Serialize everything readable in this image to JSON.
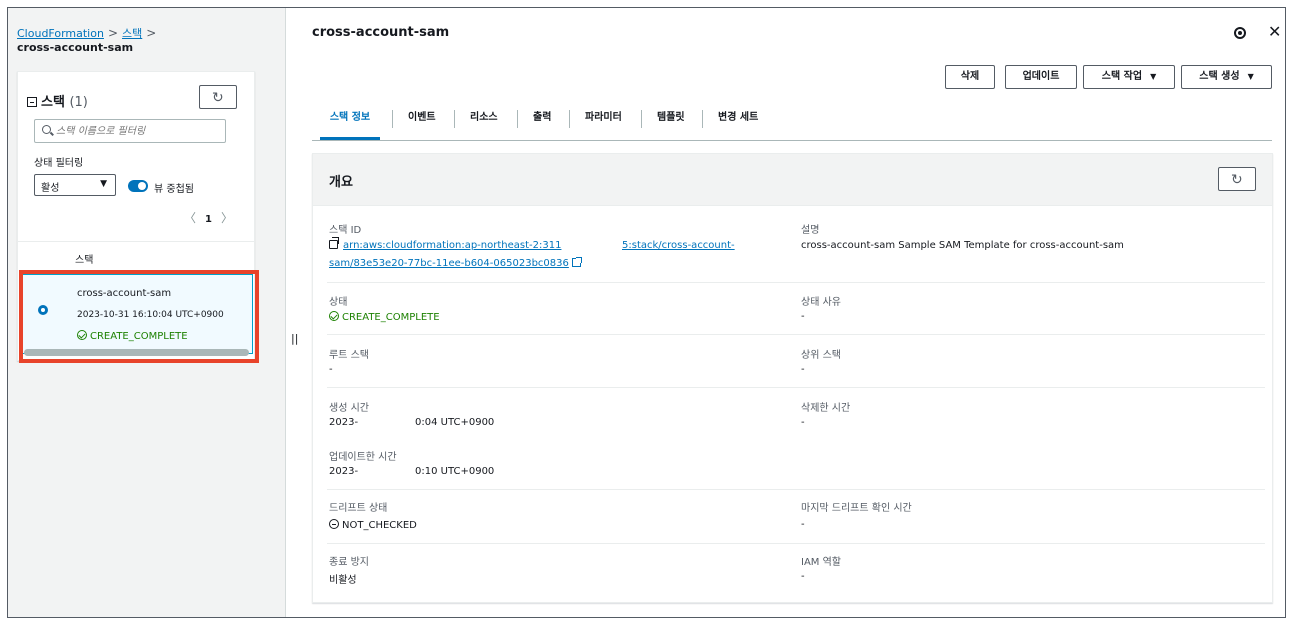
{
  "breadcrumb": {
    "root": "CloudFormation",
    "stacks": "스택",
    "current": "cross-account-sam"
  },
  "stack_list": {
    "title": "스택",
    "count": "(1)",
    "search_placeholder": "스택 이름으로 필터링",
    "filter_label": "상태 필터링",
    "filter_value": "활성",
    "toggle_label": "뷰 중첩됨",
    "page": "1",
    "column_header": "스택",
    "rows": [
      {
        "name": "cross-account-sam",
        "created": "2023-10-31 16:10:04 UTC+0900",
        "status": "CREATE_COMPLETE"
      }
    ]
  },
  "detail": {
    "title": "cross-account-sam",
    "buttons": {
      "delete": "삭제",
      "update": "업데이트",
      "stack_actions": "스택 작업",
      "create_stack": "스택 생성"
    },
    "tabs": [
      "스택 정보",
      "이벤트",
      "리소스",
      "출력",
      "파라미터",
      "템플릿",
      "변경 세트"
    ],
    "active_tab": "스택 정보",
    "overview": {
      "title": "개요",
      "stack_id_label": "스택 ID",
      "stack_id_line1_a": "arn:aws:cloudformation:ap-northeast-2:311",
      "stack_id_line1_b": "5:stack/cross-account-",
      "stack_id_line2": "sam/83e53e20-77bc-11ee-b604-065023bc0836",
      "description_label": "설명",
      "description_value": "cross-account-sam Sample SAM Template for cross-account-sam",
      "status_label": "상태",
      "status_value": "CREATE_COMPLETE",
      "status_reason_label": "상태 사유",
      "status_reason_value": "-",
      "root_stack_label": "루트 스택",
      "root_stack_value": "-",
      "parent_stack_label": "상위 스택",
      "parent_stack_value": "-",
      "created_label": "생성 시간",
      "created_value_a": "2023-",
      "created_value_b": "0:04 UTC+0900",
      "deleted_label": "삭제한 시간",
      "deleted_value": "-",
      "updated_label": "업데이트한 시간",
      "updated_value_a": "2023-",
      "updated_value_b": "0:10 UTC+0900",
      "drift_label": "드리프트 상태",
      "drift_value": "NOT_CHECKED",
      "last_drift_label": "마지막 드리프트 확인 시간",
      "last_drift_value": "-",
      "termination_label": "종료 방지",
      "termination_value": "비활성",
      "iam_label": "IAM 역할",
      "iam_value": "-"
    }
  },
  "colors": {
    "link": "#0073bb",
    "success": "#1d8102",
    "highlight": "#e8432a"
  }
}
